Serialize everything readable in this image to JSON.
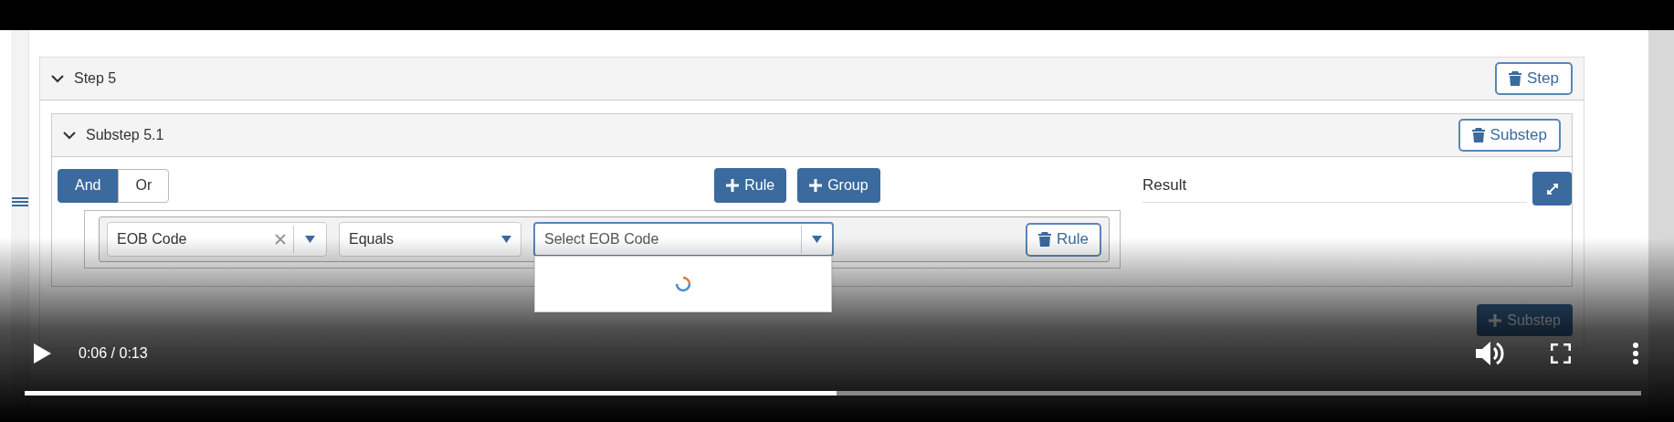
{
  "video_frame": {
    "step": {
      "title": "Step 5",
      "expanded": true,
      "delete_button": "Step"
    },
    "substep": {
      "title": "Substep 5.1",
      "expanded": true,
      "delete_button": "Substep"
    },
    "conjunctions": [
      {
        "label": "And",
        "selected": true
      },
      {
        "label": "Or",
        "selected": false
      }
    ],
    "add_buttons": [
      "Rule",
      "Group"
    ],
    "rule": {
      "field": "EOB Code",
      "operator": "Equals",
      "value_placeholder": "Select EOB Code",
      "delete_button": "Rule",
      "value_dropdown_loading": true
    },
    "result": {
      "label": "Result"
    },
    "add_substep_button": "Substep"
  },
  "player": {
    "paused": true,
    "time": "0:06 / 0:13",
    "level": 0.502
  }
}
